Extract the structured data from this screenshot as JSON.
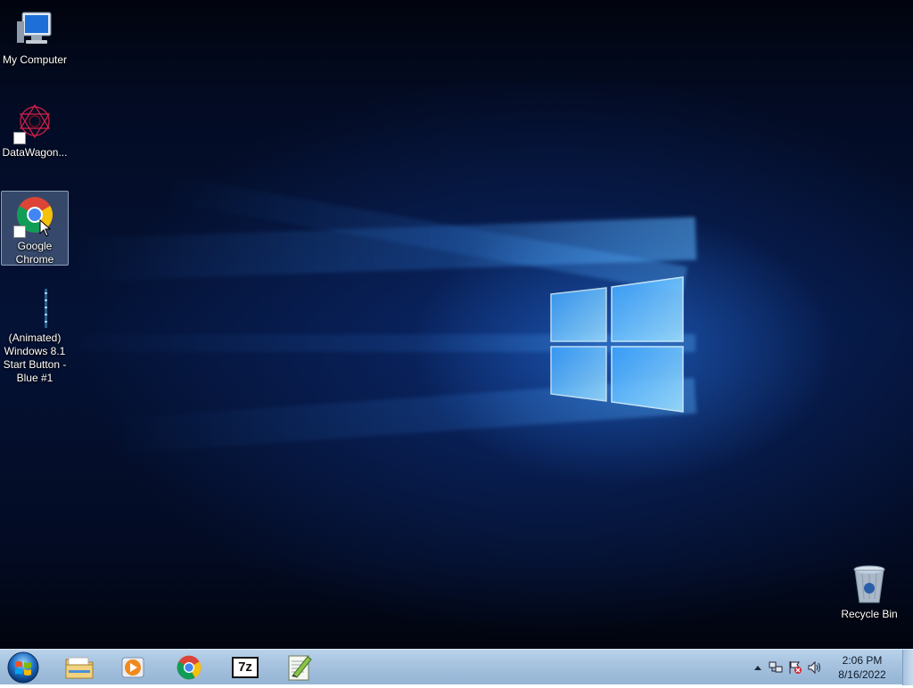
{
  "desktop": {
    "icons": [
      {
        "label": "My Computer",
        "icon": "computer-icon"
      },
      {
        "label": "DataWagon...",
        "icon": "datawagon-icon"
      },
      {
        "label": "Google Chrome",
        "icon": "chrome-icon"
      },
      {
        "label": "(Animated) Windows 8.1 Start Button - Blue #1",
        "icon": "animated-start-button-icon"
      },
      {
        "label": "Recycle Bin",
        "icon": "recycle-bin-icon"
      }
    ]
  },
  "taskbar": {
    "start_icon": "windows-start-orb-icon",
    "pinned": [
      {
        "name": "Windows Explorer",
        "icon": "folder-icon"
      },
      {
        "name": "Windows Media Player",
        "icon": "media-player-icon"
      },
      {
        "name": "Google Chrome",
        "icon": "chrome-icon"
      },
      {
        "name": "7-Zip",
        "icon": "7zip-icon"
      },
      {
        "name": "Notepad++",
        "icon": "notepadpp-icon"
      }
    ],
    "sevenzip_text": "7z",
    "tray": {
      "icons": [
        "show-hidden-icons-arrow-icon",
        "network-icon",
        "action-center-flag-icon",
        "volume-icon"
      ]
    },
    "clock": {
      "time": "2:06 PM",
      "date": "8/16/2022"
    }
  },
  "colors": {
    "wallpaper_dark": "#030b22",
    "wallpaper_glow": "#2b8cff",
    "taskbar": "#a7c3df"
  }
}
